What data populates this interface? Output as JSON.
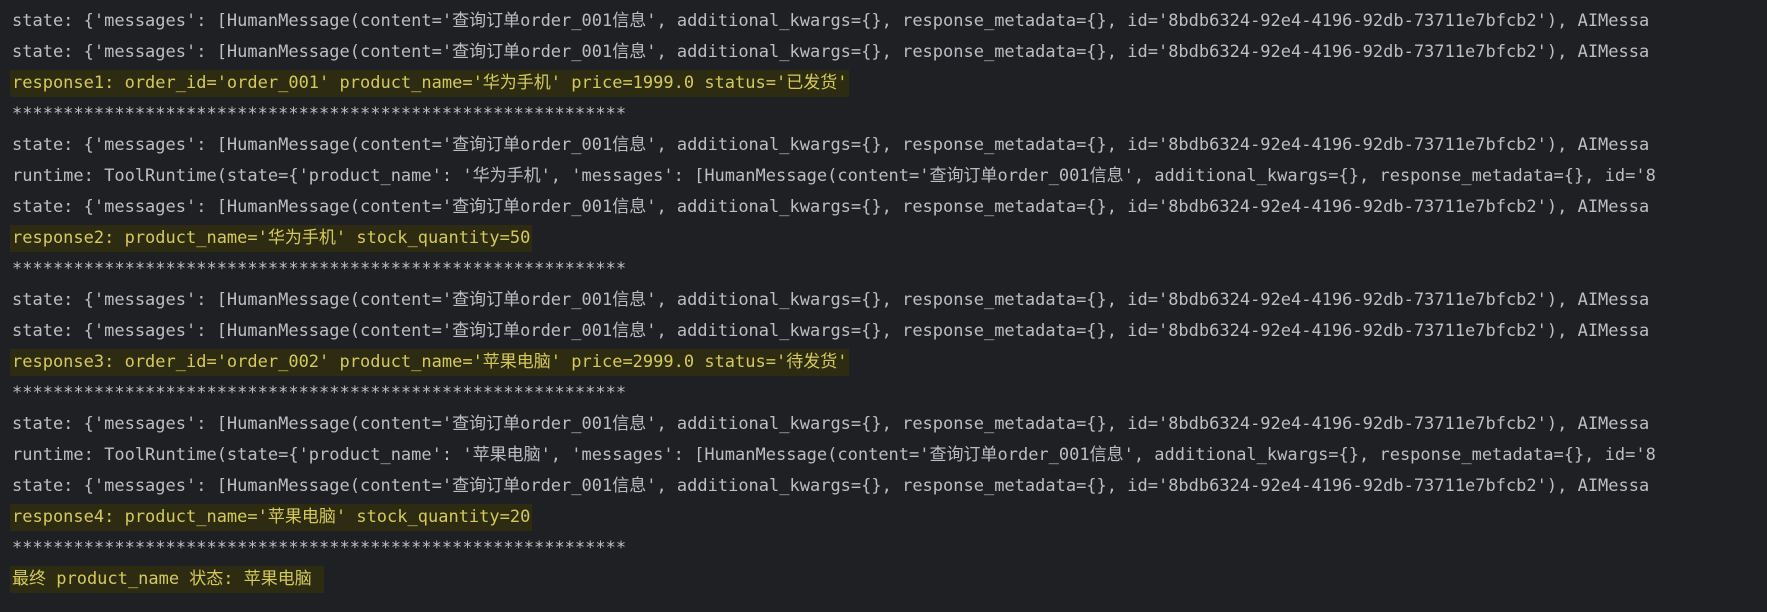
{
  "console": {
    "lines": [
      {
        "text": "state: {'messages': [HumanMessage(content='查询订单order_001信息', additional_kwargs={}, response_metadata={}, id='8bdb6324-92e4-4196-92db-73711e7bfcb2'), AIMessa",
        "highlight": false
      },
      {
        "text": "state: {'messages': [HumanMessage(content='查询订单order_001信息', additional_kwargs={}, response_metadata={}, id='8bdb6324-92e4-4196-92db-73711e7bfcb2'), AIMessa",
        "highlight": false
      },
      {
        "text": "response1: order_id='order_001' product_name='华为手机' price=1999.0 status='已发货'",
        "highlight": true
      },
      {
        "text": "************************************************************",
        "highlight": false
      },
      {
        "text": "state: {'messages': [HumanMessage(content='查询订单order_001信息', additional_kwargs={}, response_metadata={}, id='8bdb6324-92e4-4196-92db-73711e7bfcb2'), AIMessa",
        "highlight": false
      },
      {
        "text": "runtime: ToolRuntime(state={'product_name': '华为手机', 'messages': [HumanMessage(content='查询订单order_001信息', additional_kwargs={}, response_metadata={}, id='8",
        "highlight": false
      },
      {
        "text": "state: {'messages': [HumanMessage(content='查询订单order_001信息', additional_kwargs={}, response_metadata={}, id='8bdb6324-92e4-4196-92db-73711e7bfcb2'), AIMessa",
        "highlight": false
      },
      {
        "text": "response2: product_name='华为手机' stock_quantity=50",
        "highlight": true
      },
      {
        "text": "************************************************************",
        "highlight": false
      },
      {
        "text": "state: {'messages': [HumanMessage(content='查询订单order_001信息', additional_kwargs={}, response_metadata={}, id='8bdb6324-92e4-4196-92db-73711e7bfcb2'), AIMessa",
        "highlight": false
      },
      {
        "text": "state: {'messages': [HumanMessage(content='查询订单order_001信息', additional_kwargs={}, response_metadata={}, id='8bdb6324-92e4-4196-92db-73711e7bfcb2'), AIMessa",
        "highlight": false
      },
      {
        "text": "response3: order_id='order_002' product_name='苹果电脑' price=2999.0 status='待发货'",
        "highlight": true
      },
      {
        "text": "************************************************************",
        "highlight": false
      },
      {
        "text": "state: {'messages': [HumanMessage(content='查询订单order_001信息', additional_kwargs={}, response_metadata={}, id='8bdb6324-92e4-4196-92db-73711e7bfcb2'), AIMessa",
        "highlight": false
      },
      {
        "text": "runtime: ToolRuntime(state={'product_name': '苹果电脑', 'messages': [HumanMessage(content='查询订单order_001信息', additional_kwargs={}, response_metadata={}, id='8",
        "highlight": false
      },
      {
        "text": "state: {'messages': [HumanMessage(content='查询订单order_001信息', additional_kwargs={}, response_metadata={}, id='8bdb6324-92e4-4196-92db-73711e7bfcb2'), AIMessa",
        "highlight": false
      },
      {
        "text": "response4: product_name='苹果电脑' stock_quantity=20",
        "highlight": true
      },
      {
        "text": "************************************************************",
        "highlight": false
      },
      {
        "text": "最终 product_name 状态: 苹果电脑 ",
        "highlight": true
      }
    ]
  },
  "colors": {
    "background": "#1f2023",
    "text": "#bcbec4",
    "highlight_text": "#d5c95c",
    "highlight_background": "#2d2c12"
  }
}
